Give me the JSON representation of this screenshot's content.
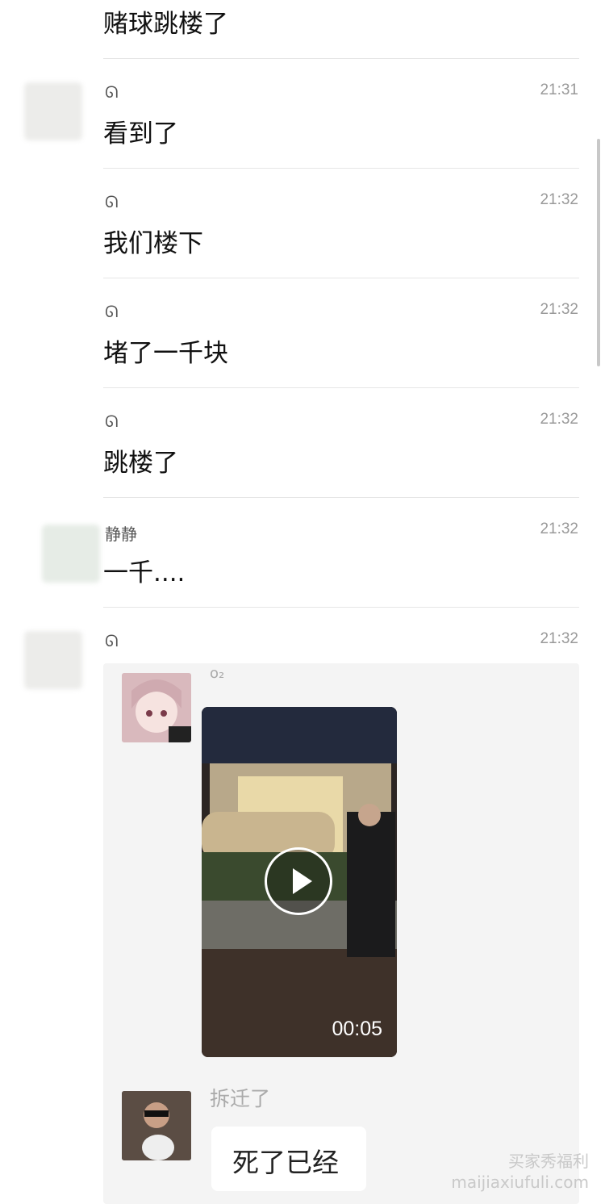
{
  "messages": [
    {
      "sender": "",
      "time": "",
      "text": "赌球跳楼了"
    },
    {
      "sender": "ᘏ",
      "time": "21:31",
      "text": "看到了"
    },
    {
      "sender": "ᘏ",
      "time": "21:32",
      "text": "我们楼下"
    },
    {
      "sender": "ᘏ",
      "time": "21:32",
      "text": "堵了一千块"
    },
    {
      "sender": "ᘏ",
      "time": "21:32",
      "text": "跳楼了"
    },
    {
      "sender": "静静",
      "time": "21:32",
      "text": "一千...."
    },
    {
      "sender": "ᘏ",
      "time": "21:32",
      "text": ""
    }
  ],
  "forwarded": {
    "first_sender": "o₂",
    "video_duration": "00:05",
    "second_sender": "拆迁了",
    "second_message": "死了已经"
  },
  "watermark": {
    "line1": "买家秀福利",
    "line2": "maijiaxiufuli.com"
  }
}
